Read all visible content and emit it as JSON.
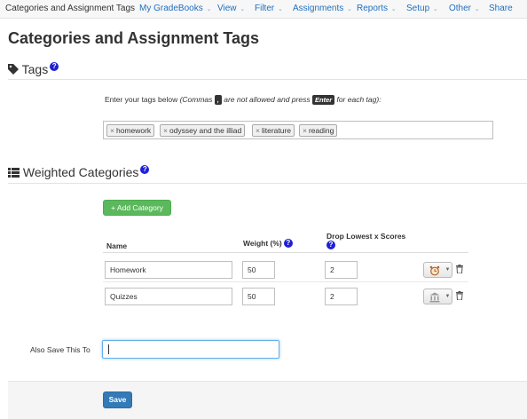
{
  "nav": {
    "brand": "Categories and Assignment Tags",
    "items": [
      {
        "label": "My GradeBooks",
        "caret": "⌄"
      },
      {
        "label": "View",
        "caret": "⌄"
      },
      {
        "label": "Filter",
        "caret": "⌄"
      },
      {
        "label": "Assignments",
        "caret": "⌄"
      },
      {
        "label": "Reports",
        "caret": "⌄"
      },
      {
        "label": "Setup",
        "caret": "⌄"
      },
      {
        "label": "Other",
        "caret": "⌄"
      },
      {
        "label": "Share",
        "caret": ""
      }
    ]
  },
  "page": {
    "title": "Categories and Assignment Tags"
  },
  "tags_section": {
    "heading": "Tags",
    "help_glyph": "?",
    "help_text_prefix": "Enter your tags below ",
    "help_italic_1": "(Commas ",
    "comma_key": ",",
    "help_italic_2": " are not allowed and press ",
    "enter_key": "Enter",
    "help_italic_3": " for each tag):",
    "remove_glyph": "×",
    "tags": [
      "homework",
      "odyssey and the illiad",
      "literature",
      "reading"
    ]
  },
  "categories_section": {
    "heading": "Weighted Categories",
    "help_glyph": "?",
    "add_button": "+ Add Category",
    "columns": {
      "name": "Name",
      "weight": "Weight (%)",
      "drop_lowest": "Drop Lowest x Scores"
    },
    "rows": [
      {
        "name": "Homework",
        "weight": "50",
        "drop": "2",
        "icon": "alarm-clock-icon"
      },
      {
        "name": "Quizzes",
        "weight": "50",
        "drop": "2",
        "icon": "bank-building-icon"
      }
    ],
    "dropdown_glyph": "▼"
  },
  "also_save": {
    "label": "Also Save This To",
    "value": ""
  },
  "footer": {
    "save_button": "Save"
  },
  "colors": {
    "link": "#1f6fbf",
    "help_badge": "#1f1fd6",
    "add_button": "#5cb85c",
    "save_button": "#337ab7",
    "focus_border": "#66afe9"
  }
}
